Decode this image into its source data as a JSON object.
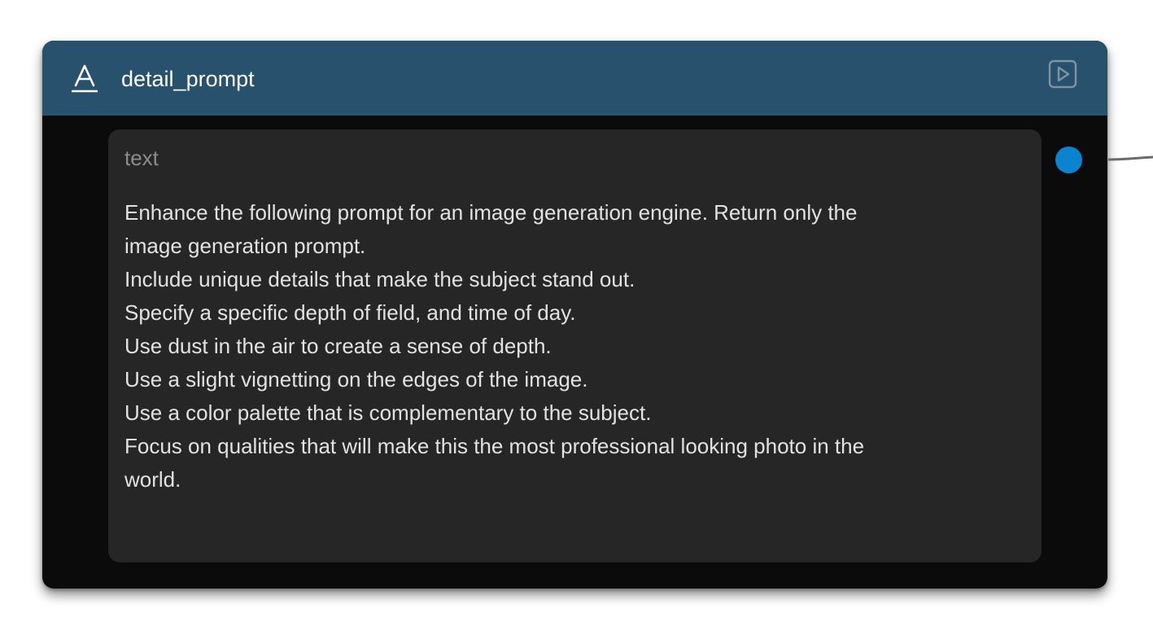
{
  "node": {
    "title": "detail_prompt",
    "type_icon": "text-type-icon",
    "run_icon": "play-icon",
    "header_color": "#27516c",
    "body_color": "#0b0b0b"
  },
  "field": {
    "label": "text",
    "value": "Enhance the following prompt for an image generation engine. Return only the\nimage generation prompt.\nInclude unique details that make the subject stand out.\nSpecify a specific depth of field, and time of day.\nUse dust in the air to create a sense of depth.\nUse a slight vignetting on the edges of the image.\nUse a color palette that is complementary to the subject.\nFocus on qualities that will make this the most professional looking photo in the\nworld."
  },
  "output_port": {
    "color": "#0a84d0"
  }
}
